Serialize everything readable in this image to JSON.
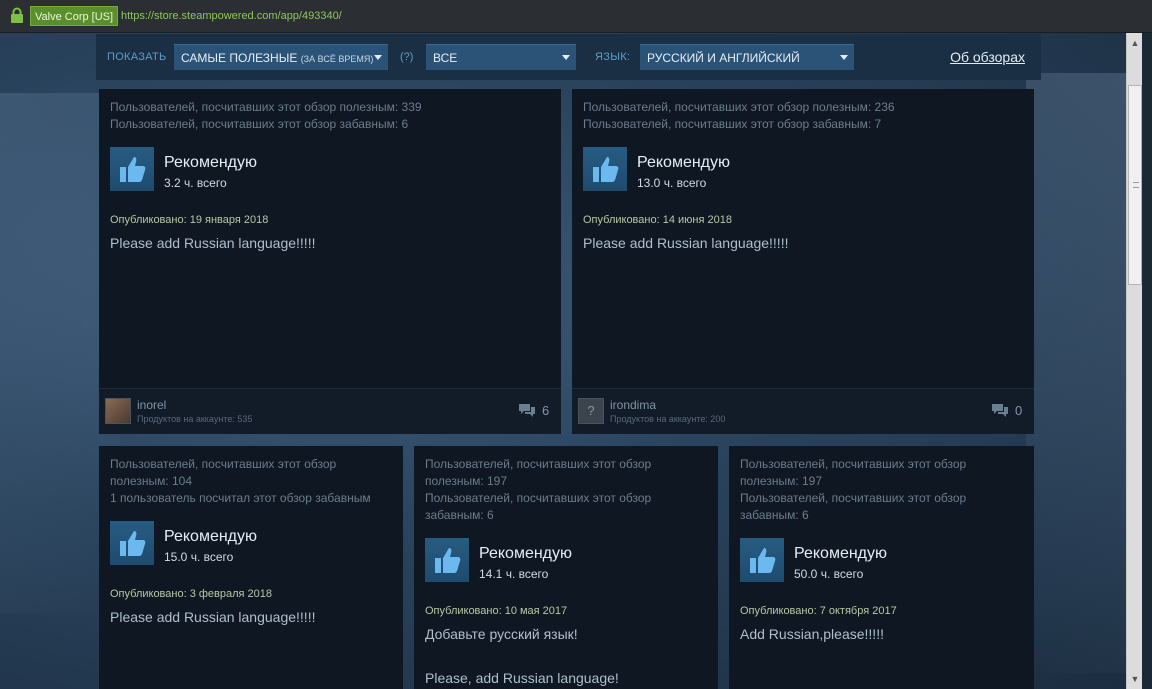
{
  "browser": {
    "cert_label": "Valve Corp [US]",
    "url": "https://store.steampowered.com/app/493340/"
  },
  "filters": {
    "show_label": "ПОКАЗАТЬ",
    "sort_value": "САМЫЕ ПОЛЕЗНЫЕ",
    "sort_sub": "(ЗА ВСЁ ВРЕМЯ)",
    "help": "(?)",
    "type_value": "ВСЕ",
    "language_label": "ЯЗЫК:",
    "language_value": "РУССКИЙ И АНГЛИЙСКИЙ",
    "about_link": "Об обзорах"
  },
  "reviews": [
    {
      "stats_line1": "Пользователей, посчитавших этот обзор полезным: 339",
      "stats_line2": "Пользователей, посчитавших этот обзор забавным: 6",
      "stats_line3": "",
      "verdict": "Рекомендую",
      "hours": "3.2 ч. всего",
      "posted": "Опубликовано: 19 января 2018",
      "text_line1": "Please add Russian language!!!!!",
      "text_line2": "",
      "username": "inorel",
      "products": "Продуктов на аккаунте: 535",
      "comments": "6"
    },
    {
      "stats_line1": "Пользователей, посчитавших этот обзор полезным: 236",
      "stats_line2": "Пользователей, посчитавших этот обзор забавным: 7",
      "stats_line3": "",
      "verdict": "Рекомендую",
      "hours": "13.0 ч. всего",
      "posted": "Опубликовано: 14 июня 2018",
      "text_line1": "Please add Russian language!!!!!",
      "text_line2": "",
      "username": "irondima",
      "products": "Продуктов на аккаунте: 200",
      "comments": "0"
    },
    {
      "stats_line1": "Пользователей, посчитавших этот обзор",
      "stats_line2": "полезным: 104",
      "stats_line3": "1 пользователь посчитал этот обзор забавным",
      "stats_line4": "",
      "verdict": "Рекомендую",
      "hours": "15.0 ч. всего",
      "posted": "Опубликовано: 3 февраля 2018",
      "text_line1": "Please add Russian language!!!!!",
      "text_line2": ""
    },
    {
      "stats_line1": "Пользователей, посчитавших этот обзор",
      "stats_line2": "полезным: 197",
      "stats_line3": "Пользователей, посчитавших этот обзор",
      "stats_line4": "забавным: 6",
      "verdict": "Рекомендую",
      "hours": "14.1 ч. всего",
      "posted": "Опубликовано: 10 мая 2017",
      "text_line1": "Добавьте русский язык!",
      "text_line2": "Please, add Russian language!"
    },
    {
      "stats_line1": "Пользователей, посчитавших этот обзор",
      "stats_line2": "полезным: 197",
      "stats_line3": "Пользователей, посчитавших этот обзор",
      "stats_line4": "забавным: 6",
      "verdict": "Рекомендую",
      "hours": "50.0 ч. всего",
      "posted": "Опубликовано: 7 октября 2017",
      "text_line1": "Add Russian,please!!!!!",
      "text_line2": ""
    }
  ],
  "icons": {
    "lock": "lock-icon",
    "thumb": "thumbs-up-icon",
    "comment": "comment-icon",
    "dropdown": "chevron-down-icon"
  },
  "colors": {
    "accent": "#5d9bc7",
    "dropdown_bg": "#2b5377",
    "card_bg": "#0f1722",
    "cert_green": "#5a8f2b"
  }
}
